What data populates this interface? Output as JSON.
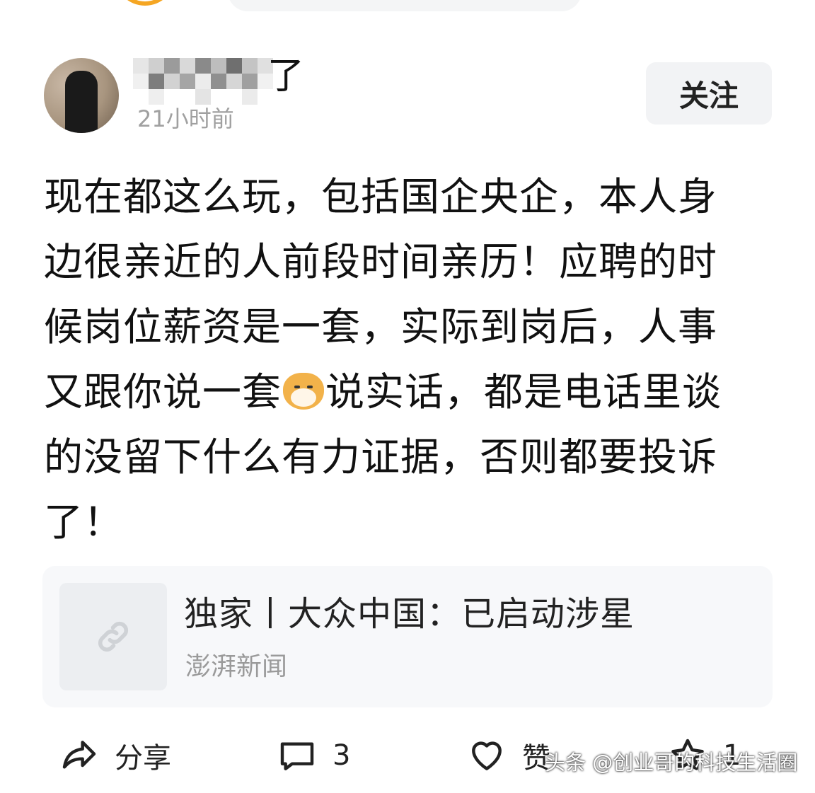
{
  "post": {
    "author": {
      "name_visible": "了",
      "time": "21小时前"
    },
    "follow_label": "关注",
    "text_lines": [
      "现在都这么玩，包括国企央企，本人身",
      "边很亲近的人前段时间亲历！应聘的时",
      "候岗位薪资是一套，实际到岗后，人事",
      "又跟你说一套",
      "说实话，都是电话里谈",
      "的没留下什么有力证据，否则都要投诉",
      "了！"
    ],
    "emoji_icon": "doge-icon"
  },
  "link_card": {
    "title": "独家丨大众中国：已启动涉星",
    "source": "澎湃新闻",
    "icon": "link-icon"
  },
  "actions": {
    "share_label": "分享",
    "comment_count": "3",
    "like_label": "赞",
    "favorite_count": "1"
  },
  "watermark": "头条 @创业哥的科技生活圈",
  "colors": {
    "follow_bg": "#f2f3f5",
    "card_bg": "#f7f8fa",
    "muted_text": "#a0a0a0",
    "top_avatar_ring": "#f5a623"
  }
}
